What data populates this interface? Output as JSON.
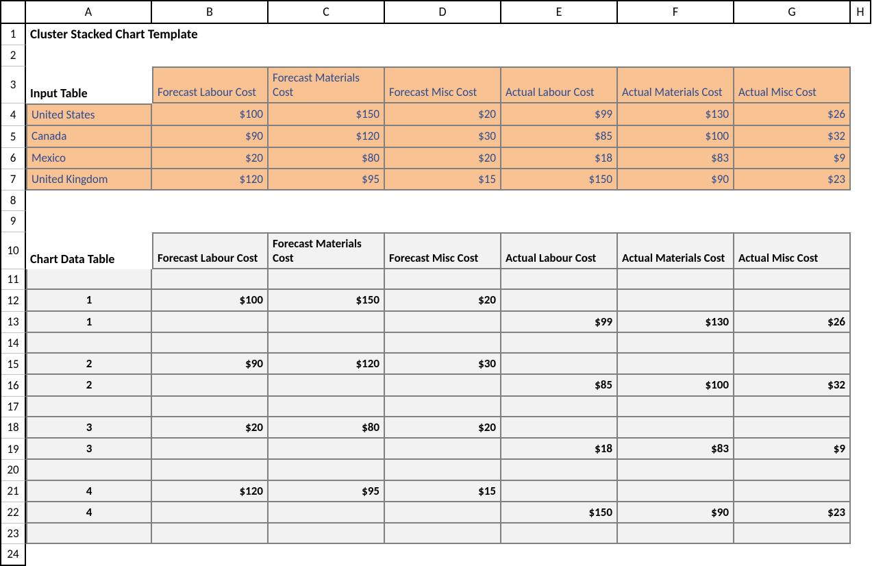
{
  "columns": [
    "A",
    "B",
    "C",
    "D",
    "E",
    "F",
    "G",
    "H"
  ],
  "row_count": 24,
  "title": "Cluster Stacked Chart Template",
  "input_table": {
    "label": "Input Table",
    "headers": [
      "Forecast Labour Cost",
      "Forecast Materials Cost",
      "Forecast Misc Cost",
      "Actual Labour Cost",
      "Actual Materials Cost",
      "Actual Misc Cost"
    ],
    "rows": [
      {
        "name": "United States",
        "values": [
          "$100",
          "$150",
          "$20",
          "$99",
          "$130",
          "$26"
        ]
      },
      {
        "name": "Canada",
        "values": [
          "$90",
          "$120",
          "$30",
          "$85",
          "$100",
          "$32"
        ]
      },
      {
        "name": "Mexico",
        "values": [
          "$20",
          "$80",
          "$20",
          "$18",
          "$83",
          "$9"
        ]
      },
      {
        "name": "United Kingdom",
        "values": [
          "$120",
          "$95",
          "$15",
          "$150",
          "$90",
          "$23"
        ]
      }
    ]
  },
  "chart_table": {
    "label": "Chart Data Table",
    "headers": [
      "Forecast Labour Cost",
      "Forecast Materials Cost",
      "Forecast Misc Cost",
      "Actual Labour Cost",
      "Actual Materials Cost",
      "Actual Misc Cost"
    ],
    "rows": [
      {
        "a": "",
        "v": [
          "",
          "",
          "",
          "",
          "",
          ""
        ]
      },
      {
        "a": "1",
        "v": [
          "$100",
          "$150",
          "$20",
          "",
          "",
          ""
        ]
      },
      {
        "a": "1",
        "v": [
          "",
          "",
          "",
          "$99",
          "$130",
          "$26"
        ]
      },
      {
        "a": "",
        "v": [
          "",
          "",
          "",
          "",
          "",
          ""
        ]
      },
      {
        "a": "2",
        "v": [
          "$90",
          "$120",
          "$30",
          "",
          "",
          ""
        ]
      },
      {
        "a": "2",
        "v": [
          "",
          "",
          "",
          "$85",
          "$100",
          "$32"
        ]
      },
      {
        "a": "",
        "v": [
          "",
          "",
          "",
          "",
          "",
          ""
        ]
      },
      {
        "a": "3",
        "v": [
          "$20",
          "$80",
          "$20",
          "",
          "",
          ""
        ]
      },
      {
        "a": "3",
        "v": [
          "",
          "",
          "",
          "$18",
          "$83",
          "$9"
        ]
      },
      {
        "a": "",
        "v": [
          "",
          "",
          "",
          "",
          "",
          ""
        ]
      },
      {
        "a": "4",
        "v": [
          "$120",
          "$95",
          "$15",
          "",
          "",
          ""
        ]
      },
      {
        "a": "4",
        "v": [
          "",
          "",
          "",
          "$150",
          "$90",
          "$23"
        ]
      },
      {
        "a": "",
        "v": [
          "",
          "",
          "",
          "",
          "",
          ""
        ]
      }
    ]
  }
}
